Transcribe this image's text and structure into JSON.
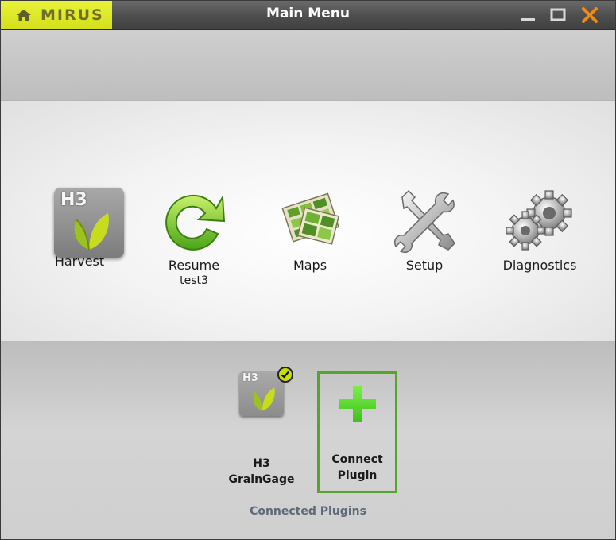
{
  "brand": {
    "name": "MIRUS",
    "color": "#d4e01a"
  },
  "window": {
    "title": "Main Menu"
  },
  "menu": {
    "items": [
      {
        "label": "Harvest",
        "sublabel": "",
        "icon": "h3-harvest-icon",
        "tile_text": "H3"
      },
      {
        "label": "Resume",
        "sublabel": "test3",
        "icon": "resume-arrow-icon"
      },
      {
        "label": "Maps",
        "sublabel": "",
        "icon": "maps-icon"
      },
      {
        "label": "Setup",
        "sublabel": "",
        "icon": "wrench-screwdriver-icon"
      },
      {
        "label": "Diagnostics",
        "sublabel": "",
        "icon": "gears-icon"
      }
    ]
  },
  "plugins": {
    "caption": "Connected Plugins",
    "items": [
      {
        "label_line1": "H3",
        "label_line2": "GrainGage",
        "tile_text": "H3",
        "connected": true,
        "icon": "h3-graingage-icon"
      },
      {
        "label_line1": "Connect",
        "label_line2": "Plugin",
        "icon": "plus-icon",
        "accent": "#56a42a"
      }
    ]
  }
}
